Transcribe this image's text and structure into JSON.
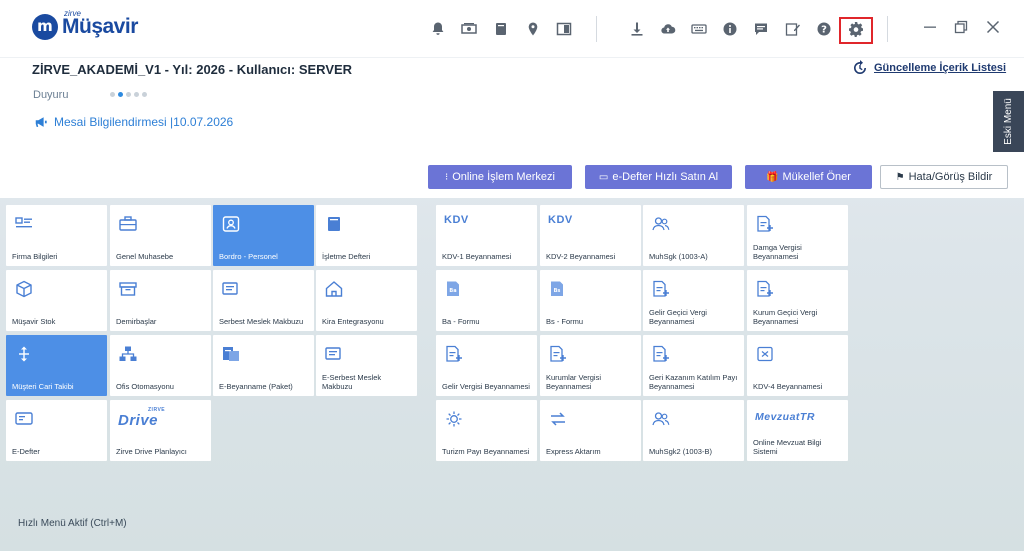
{
  "app": {
    "logo_small": "zirve",
    "logo_main": "Müşavir",
    "logo_letter": "m"
  },
  "header": {
    "company_title": "ZİRVE_AKADEMİ_V1 - Yıl: 2026 - Kullanıcı: SERVER",
    "update_link": "Güncelleme İçerik Listesi",
    "duyuru_label": "Duyuru",
    "announcement": "Mesai Bilgilendirmesi |10.07.2026",
    "eski_menu": "Eski Menü"
  },
  "toolbar_icons": [
    "bell-icon",
    "money-icon",
    "book-icon",
    "location-icon",
    "panel-icon",
    "download-icon",
    "cloud-upload-icon",
    "keyboard-icon",
    "info-icon",
    "chat-icon",
    "edit-icon",
    "help-icon",
    "gear-icon"
  ],
  "actions": [
    {
      "label": "Online İşlem Merkezi",
      "icon": "⁝"
    },
    {
      "label": "e-Defter Hızlı Satın Al",
      "icon": "▭"
    },
    {
      "label": "Mükellef Öner",
      "icon": "🎁"
    },
    {
      "label": "Hata/Görüş Bildir",
      "icon": "⚑"
    }
  ],
  "tiles": [
    {
      "label": "Firma Bilgileri"
    },
    {
      "label": "Genel Muhasebe"
    },
    {
      "label": "Bordro - Personel"
    },
    {
      "label": "İşletme Defteri"
    },
    {
      "label": "Müşavir Stok"
    },
    {
      "label": "Demirbaşlar"
    },
    {
      "label": "Serbest Meslek Makbuzu"
    },
    {
      "label": "Kira Entegrasyonu"
    },
    {
      "label": "Müşteri Cari Takibi"
    },
    {
      "label": "Ofis Otomasyonu"
    },
    {
      "label": "E-Beyanname (Paket)"
    },
    {
      "label": "E-Serbest Meslek Makbuzu"
    },
    {
      "label": "E-Defter"
    },
    {
      "label": "Zirve Drive Planlayıcı",
      "logo": "Drive",
      "logo_small": "ZIRVE"
    },
    {
      "label": "KDV-1 Beyannamesi",
      "logo": "KDV"
    },
    {
      "label": "KDV-2 Beyannamesi",
      "logo": "KDV"
    },
    {
      "label": "MuhSgk (1003-A)"
    },
    {
      "label": "Damga Vergisi Beyannamesi"
    },
    {
      "label": "Ba - Formu"
    },
    {
      "label": "Bs - Formu"
    },
    {
      "label": "Gelir Geçici Vergi Beyannamesi"
    },
    {
      "label": "Kurum Geçici Vergi Beyannamesi"
    },
    {
      "label": "Gelir Vergisi Beyannamesi"
    },
    {
      "label": "Kurumlar Vergisi Beyannamesi"
    },
    {
      "label": "Geri Kazanım Katılım Payı Beyannamesi"
    },
    {
      "label": "KDV-4 Beyannamesi"
    },
    {
      "label": "Turizm Payı Beyannamesi"
    },
    {
      "label": "Express Aktarım"
    },
    {
      "label": "MuhSgk2 (1003-B)"
    },
    {
      "label": "Online Mevzuat Bilgi Sistemi",
      "logo": "MevzuatTR"
    }
  ],
  "footer": {
    "hint": "Hızlı Menü Aktif (Ctrl+M)"
  },
  "colors": {
    "brand": "#1a4aa0",
    "accent_button": "#6b74d6",
    "selected_tile": "#4d8fe6",
    "highlight": "#e0262b",
    "eski_menu": "#3a4658"
  }
}
